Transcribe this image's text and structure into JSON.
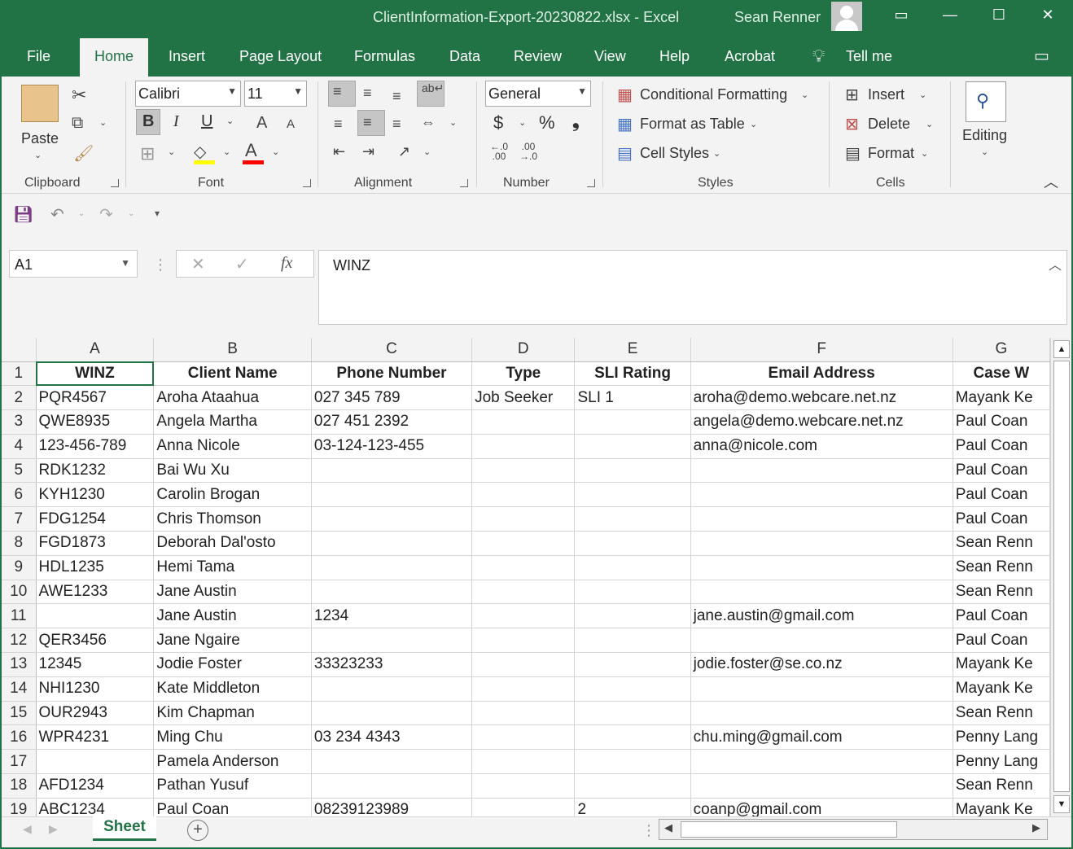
{
  "window": {
    "title": "ClientInformation-Export-20230822.xlsx  -  Excel",
    "user": "Sean Renner"
  },
  "tabs": [
    "File",
    "Home",
    "Insert",
    "Page Layout",
    "Formulas",
    "Data",
    "Review",
    "View",
    "Help",
    "Acrobat",
    "Tell me"
  ],
  "ribbon": {
    "clipboard": {
      "paste": "Paste",
      "label": "Clipboard"
    },
    "font": {
      "name": "Calibri",
      "size": "11",
      "bold": "B",
      "italic": "I",
      "underline": "U",
      "label": "Font"
    },
    "alignment": {
      "label": "Alignment"
    },
    "number": {
      "format": "General",
      "currency": "$",
      "percent": "%",
      "comma": "❟",
      "label": "Number"
    },
    "styles": {
      "conditional": "Conditional Formatting",
      "table": "Format as Table",
      "cell": "Cell Styles",
      "label": "Styles"
    },
    "cells": {
      "insert": "Insert",
      "delete": "Delete",
      "format": "Format",
      "label": "Cells"
    },
    "editing": {
      "label": "Editing"
    }
  },
  "formula_bar": {
    "name_box": "A1",
    "fx": "fx",
    "value": "WINZ"
  },
  "columns": [
    "A",
    "B",
    "C",
    "D",
    "E",
    "F",
    "G"
  ],
  "rows": [
    {
      "n": "1",
      "cells": [
        "WINZ",
        "Client Name",
        "Phone Number",
        "Type",
        "SLI Rating",
        "Email Address",
        "Case W"
      ]
    },
    {
      "n": "2",
      "cells": [
        "PQR4567",
        "Aroha Ataahua",
        "027 345 789",
        "Job Seeker",
        "SLI 1",
        "aroha@demo.webcare.net.nz",
        "Mayank Ke"
      ]
    },
    {
      "n": "3",
      "cells": [
        "QWE8935",
        "Angela Martha",
        "027 451 2392",
        "",
        "",
        "angela@demo.webcare.net.nz",
        "Paul Coan"
      ]
    },
    {
      "n": "4",
      "cells": [
        "123-456-789",
        "Anna Nicole",
        "03-124-123-455",
        "",
        "",
        "anna@nicole.com",
        "Paul Coan"
      ]
    },
    {
      "n": "5",
      "cells": [
        "RDK1232",
        "Bai Wu Xu",
        "",
        "",
        "",
        "",
        "Paul Coan"
      ]
    },
    {
      "n": "6",
      "cells": [
        "KYH1230",
        "Carolin Brogan",
        "",
        "",
        "",
        "",
        "Paul Coan"
      ]
    },
    {
      "n": "7",
      "cells": [
        "FDG1254",
        "Chris Thomson",
        "",
        "",
        "",
        "",
        "Paul Coan"
      ]
    },
    {
      "n": "8",
      "cells": [
        "FGD1873",
        "Deborah Dal'osto",
        "",
        "",
        "",
        "",
        "Sean Renn"
      ]
    },
    {
      "n": "9",
      "cells": [
        "HDL1235",
        "Hemi Tama",
        "",
        "",
        "",
        "",
        "Sean Renn"
      ]
    },
    {
      "n": "10",
      "cells": [
        "AWE1233",
        "Jane Austin",
        "",
        "",
        "",
        "",
        "Sean Renn"
      ]
    },
    {
      "n": "11",
      "cells": [
        "",
        "Jane Austin",
        "1234",
        "",
        "",
        "jane.austin@gmail.com",
        "Paul Coan"
      ]
    },
    {
      "n": "12",
      "cells": [
        "QER3456",
        "Jane Ngaire",
        "",
        "",
        "",
        "",
        "Paul Coan"
      ]
    },
    {
      "n": "13",
      "cells": [
        "12345",
        "Jodie Foster",
        "33323233",
        "",
        "",
        "jodie.foster@se.co.nz",
        "Mayank Ke"
      ]
    },
    {
      "n": "14",
      "cells": [
        "NHI1230",
        "Kate Middleton",
        "",
        "",
        "",
        "",
        "Mayank Ke"
      ]
    },
    {
      "n": "15",
      "cells": [
        "OUR2943",
        "Kim Chapman",
        "",
        "",
        "",
        "",
        "Sean Renn"
      ]
    },
    {
      "n": "16",
      "cells": [
        "WPR4231",
        "Ming Chu",
        "03 234 4343",
        "",
        "",
        "chu.ming@gmail.com",
        "Penny Lang"
      ]
    },
    {
      "n": "17",
      "cells": [
        "",
        "Pamela Anderson",
        "",
        "",
        "",
        "",
        "Penny Lang"
      ]
    },
    {
      "n": "18",
      "cells": [
        "AFD1234",
        "Pathan Yusuf",
        "",
        "",
        "",
        "",
        "Sean Renn"
      ]
    },
    {
      "n": "19",
      "cells": [
        "ABC1234",
        "Paul Coan",
        "08239123989",
        "",
        "2",
        "coanp@gmail.com",
        "Mayank Ke"
      ]
    }
  ],
  "sheet_tab": "Sheet",
  "colors": {
    "accent": "#217346"
  }
}
